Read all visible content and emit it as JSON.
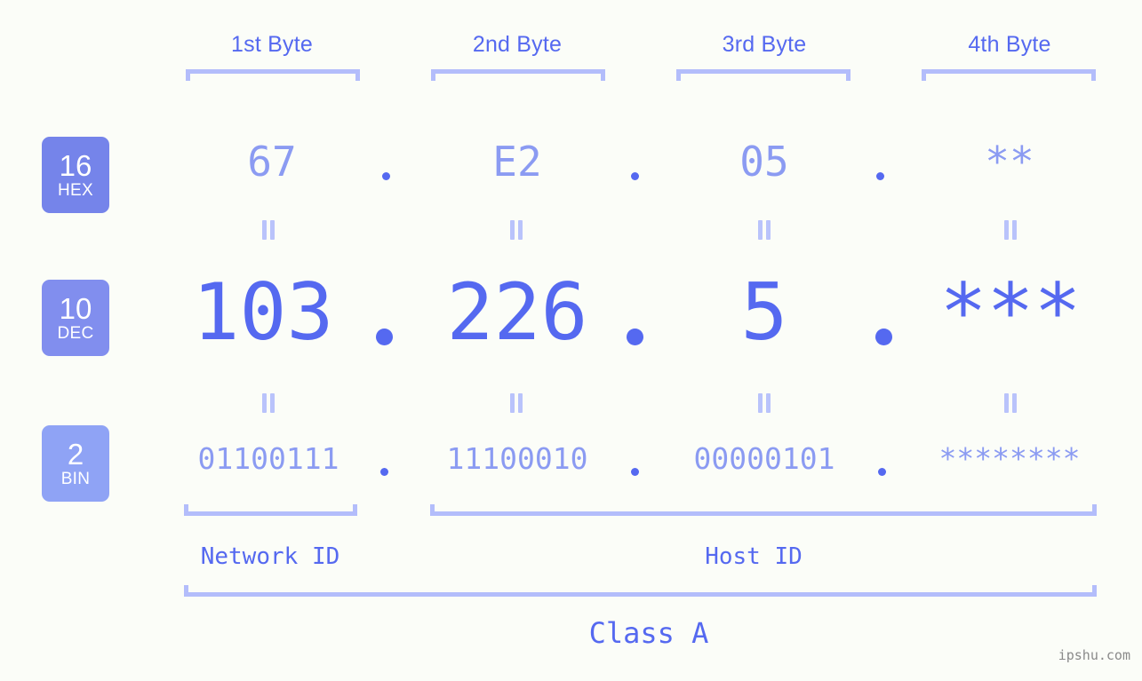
{
  "page": {
    "background_color": "#fbfdf8",
    "accent_dark": "#5569f0",
    "accent_mid": "#8b9bf2",
    "accent_light": "#b3bdfb",
    "watermark": "ipshu.com"
  },
  "byte_headers": [
    {
      "label": "1st Byte"
    },
    {
      "label": "2nd Byte"
    },
    {
      "label": "3rd Byte"
    },
    {
      "label": "4th Byte"
    }
  ],
  "bases": [
    {
      "number": "16",
      "name": "HEX",
      "color": "#7584ea"
    },
    {
      "number": "10",
      "name": "DEC",
      "color": "#818eee"
    },
    {
      "number": "2",
      "name": "BIN",
      "color": "#8fa3f5"
    }
  ],
  "rows": {
    "hex": {
      "values": [
        "67",
        "E2",
        "05",
        "**"
      ],
      "separator": "."
    },
    "dec": {
      "values": [
        "103",
        "226",
        "5",
        "***"
      ],
      "separator": "."
    },
    "bin": {
      "values": [
        "01100111",
        "11100010",
        "00000101",
        "********"
      ],
      "separator": "."
    }
  },
  "equals_marks": {
    "glyph": "||",
    "count_per_gap": 4
  },
  "sections": [
    {
      "label": "Network ID"
    },
    {
      "label": "Host ID"
    }
  ],
  "class": {
    "label": "Class A"
  }
}
